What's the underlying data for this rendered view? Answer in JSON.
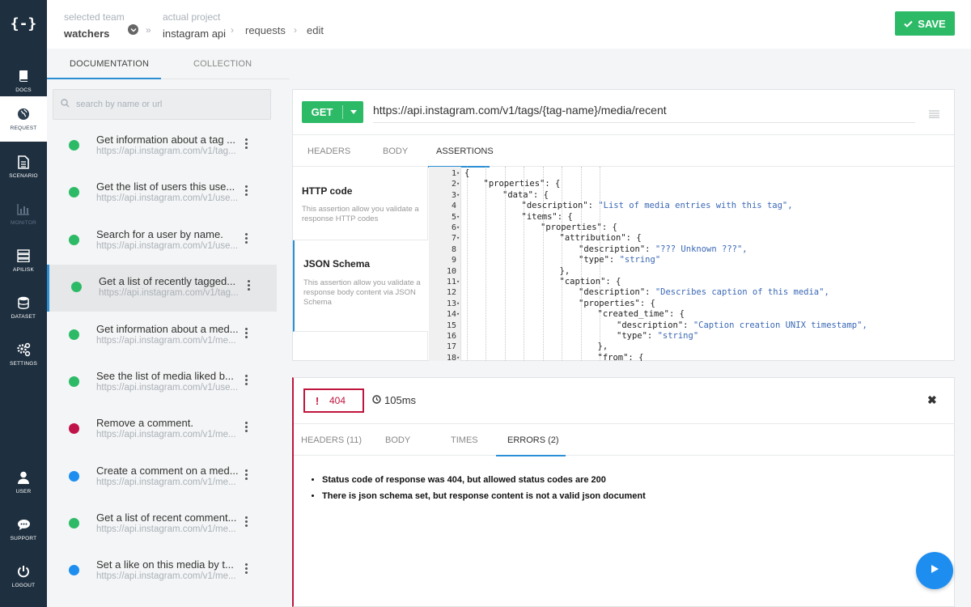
{
  "app": {
    "logo": "{-}"
  },
  "nav": {
    "top": [
      {
        "label": "DOCS",
        "icon": "book-icon"
      },
      {
        "label": "REQUEST",
        "icon": "globe-icon"
      },
      {
        "label": "SCENARIO",
        "icon": "document-icon"
      },
      {
        "label": "MONITOR",
        "icon": "bar-chart-icon"
      },
      {
        "label": "APILISK",
        "icon": "server-icon"
      },
      {
        "label": "DATASET",
        "icon": "database-icon"
      },
      {
        "label": "SETTINGS",
        "icon": "gears-icon"
      }
    ],
    "bottom": [
      {
        "label": "USER",
        "icon": "user-icon"
      },
      {
        "label": "SUPPORT",
        "icon": "chat-icon"
      },
      {
        "label": "LOGOUT",
        "icon": "power-icon"
      }
    ]
  },
  "header": {
    "team_label": "selected team",
    "team_value": "watchers",
    "project_label": "actual project",
    "project_value": "instagram api",
    "crumb_requests": "requests",
    "crumb_edit": "edit",
    "save_label": "SAVE"
  },
  "doc_tabs": {
    "documentation": "DOCUMENTATION",
    "collection": "COLLECTION"
  },
  "search": {
    "placeholder": "search by name or url",
    "value": ""
  },
  "requests": [
    {
      "title": "Get information about a tag ...",
      "url": "https://api.instagram.com/v1/tag...",
      "status_color": "#2dba67"
    },
    {
      "title": "Get the list of users this use...",
      "url": "https://api.instagram.com/v1/use...",
      "status_color": "#2dba67"
    },
    {
      "title": "Search for a user by name.",
      "url": "https://api.instagram.com/v1/use...",
      "status_color": "#2dba67"
    },
    {
      "title": "Get a list of recently tagged...",
      "url": "https://api.instagram.com/v1/tag...",
      "status_color": "#2dba67"
    },
    {
      "title": "Get information about a med...",
      "url": "https://api.instagram.com/v1/me...",
      "status_color": "#2dba67"
    },
    {
      "title": "See the list of media liked b...",
      "url": "https://api.instagram.com/v1/use...",
      "status_color": "#2dba67"
    },
    {
      "title": "Remove a comment.",
      "url": "https://api.instagram.com/v1/me...",
      "status_color": "#c0134a"
    },
    {
      "title": "Create a comment on a med...",
      "url": "https://api.instagram.com/v1/me...",
      "status_color": "#1d8ef0"
    },
    {
      "title": "Get a list of recent comment...",
      "url": "https://api.instagram.com/v1/me...",
      "status_color": "#2dba67"
    },
    {
      "title": "Set a like on this media by t...",
      "url": "https://api.instagram.com/v1/me...",
      "status_color": "#1d8ef0"
    }
  ],
  "request": {
    "method": "GET",
    "url": "https://api.instagram.com/v1/tags/{tag-name}/media/recent",
    "tabs": {
      "headers": "HEADERS",
      "body": "BODY",
      "assertions": "ASSERTIONS"
    },
    "assertions": [
      {
        "title": "HTTP code",
        "desc": "This assertion allow you validate a response HTTP codes"
      },
      {
        "title": "JSON Schema",
        "desc": "This assertion allow you validate a response body content via JSON Schema"
      }
    ],
    "code_lines": [
      {
        "n": "1",
        "fold": "▾",
        "indent": 0,
        "text": "{",
        "val": ""
      },
      {
        "n": "2",
        "fold": "▾",
        "indent": 1,
        "text": "\"properties\": {",
        "val": ""
      },
      {
        "n": "3",
        "fold": "▾",
        "indent": 2,
        "text": "\"data\": {",
        "val": ""
      },
      {
        "n": "4",
        "fold": "",
        "indent": 3,
        "text": "\"description\": ",
        "val": "\"List of media entries with this tag\","
      },
      {
        "n": "5",
        "fold": "▾",
        "indent": 3,
        "text": "\"items\": {",
        "val": ""
      },
      {
        "n": "6",
        "fold": "▾",
        "indent": 4,
        "text": "\"properties\": {",
        "val": ""
      },
      {
        "n": "7",
        "fold": "▾",
        "indent": 5,
        "text": "\"attribution\": {",
        "val": ""
      },
      {
        "n": "8",
        "fold": "",
        "indent": 6,
        "text": "\"description\": ",
        "val": "\"??? Unknown ???\","
      },
      {
        "n": "9",
        "fold": "",
        "indent": 6,
        "text": "\"type\": ",
        "val": "\"string\""
      },
      {
        "n": "10",
        "fold": "",
        "indent": 5,
        "text": "},",
        "val": ""
      },
      {
        "n": "11",
        "fold": "▾",
        "indent": 5,
        "text": "\"caption\": {",
        "val": ""
      },
      {
        "n": "12",
        "fold": "",
        "indent": 6,
        "text": "\"description\": ",
        "val": "\"Describes caption of this media\","
      },
      {
        "n": "13",
        "fold": "▾",
        "indent": 6,
        "text": "\"properties\": {",
        "val": ""
      },
      {
        "n": "14",
        "fold": "▾",
        "indent": 7,
        "text": "\"created_time\": {",
        "val": ""
      },
      {
        "n": "15",
        "fold": "",
        "indent": 8,
        "text": "\"description\": ",
        "val": "\"Caption creation UNIX timestamp\","
      },
      {
        "n": "16",
        "fold": "",
        "indent": 8,
        "text": "\"type\": ",
        "val": "\"string\""
      },
      {
        "n": "17",
        "fold": "",
        "indent": 7,
        "text": "},",
        "val": ""
      },
      {
        "n": "18",
        "fold": "▾",
        "indent": 7,
        "text": "\"from\": {",
        "val": ""
      }
    ]
  },
  "response": {
    "status_code": "404",
    "time": "105ms",
    "tabs": {
      "headers": "HEADERS (11)",
      "body": "BODY",
      "times": "TIMES",
      "errors": "ERRORS (2)"
    },
    "errors": [
      "Status code of response was 404, but allowed status codes are 200",
      "There is json schema set, but response content is not a valid json document"
    ]
  },
  "colors": {
    "green": "#2dba67",
    "blue": "#1d8ef0",
    "error": "#c0143c",
    "nav_bg": "#1e2f3f"
  }
}
